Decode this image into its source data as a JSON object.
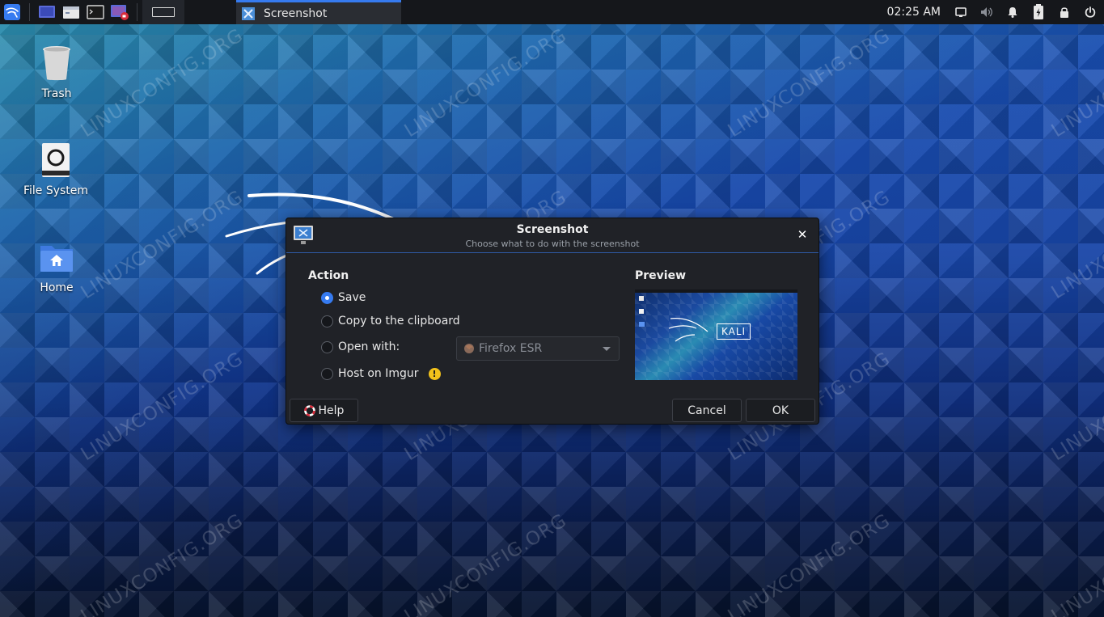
{
  "colors": {
    "accent": "#367bf0",
    "panel_bg": "#15171b",
    "dialog_bg": "#202227",
    "warning": "#f2c21b"
  },
  "watermark": "LINUXCONFIG.ORG",
  "top_panel": {
    "launcher_icon": "kali-dragon-icon",
    "quick_launch": [
      {
        "name": "show-desktop-icon"
      },
      {
        "name": "file-manager-icon"
      },
      {
        "name": "terminal-icon"
      },
      {
        "name": "screen-recorder-icon"
      }
    ],
    "task": {
      "label": "Screenshot",
      "icon": "screenshot-app-icon"
    },
    "clock": "02:25 AM",
    "tray_icons": [
      "display-icon",
      "volume-icon",
      "notification-bell-icon",
      "battery-charging-icon",
      "lock-icon",
      "power-icon"
    ]
  },
  "desktop": {
    "icons": [
      {
        "label": "Trash",
        "icon": "trash-icon"
      },
      {
        "label": "File System",
        "icon": "drive-icon"
      },
      {
        "label": "Home",
        "icon": "home-folder-icon"
      }
    ]
  },
  "dialog": {
    "title": "Screenshot",
    "subtitle": "Choose what to do with the screenshot",
    "action_label": "Action",
    "preview_label": "Preview",
    "options": [
      {
        "label": "Save",
        "checked": true
      },
      {
        "label": "Copy to the clipboard",
        "checked": false
      },
      {
        "label": "Open with:",
        "checked": false
      },
      {
        "label": "Host on Imgur",
        "checked": false
      }
    ],
    "open_with_app": "Firefox ESR",
    "preview_logo_text": "KALI",
    "buttons": {
      "help": "Help",
      "cancel": "Cancel",
      "ok": "OK"
    }
  }
}
